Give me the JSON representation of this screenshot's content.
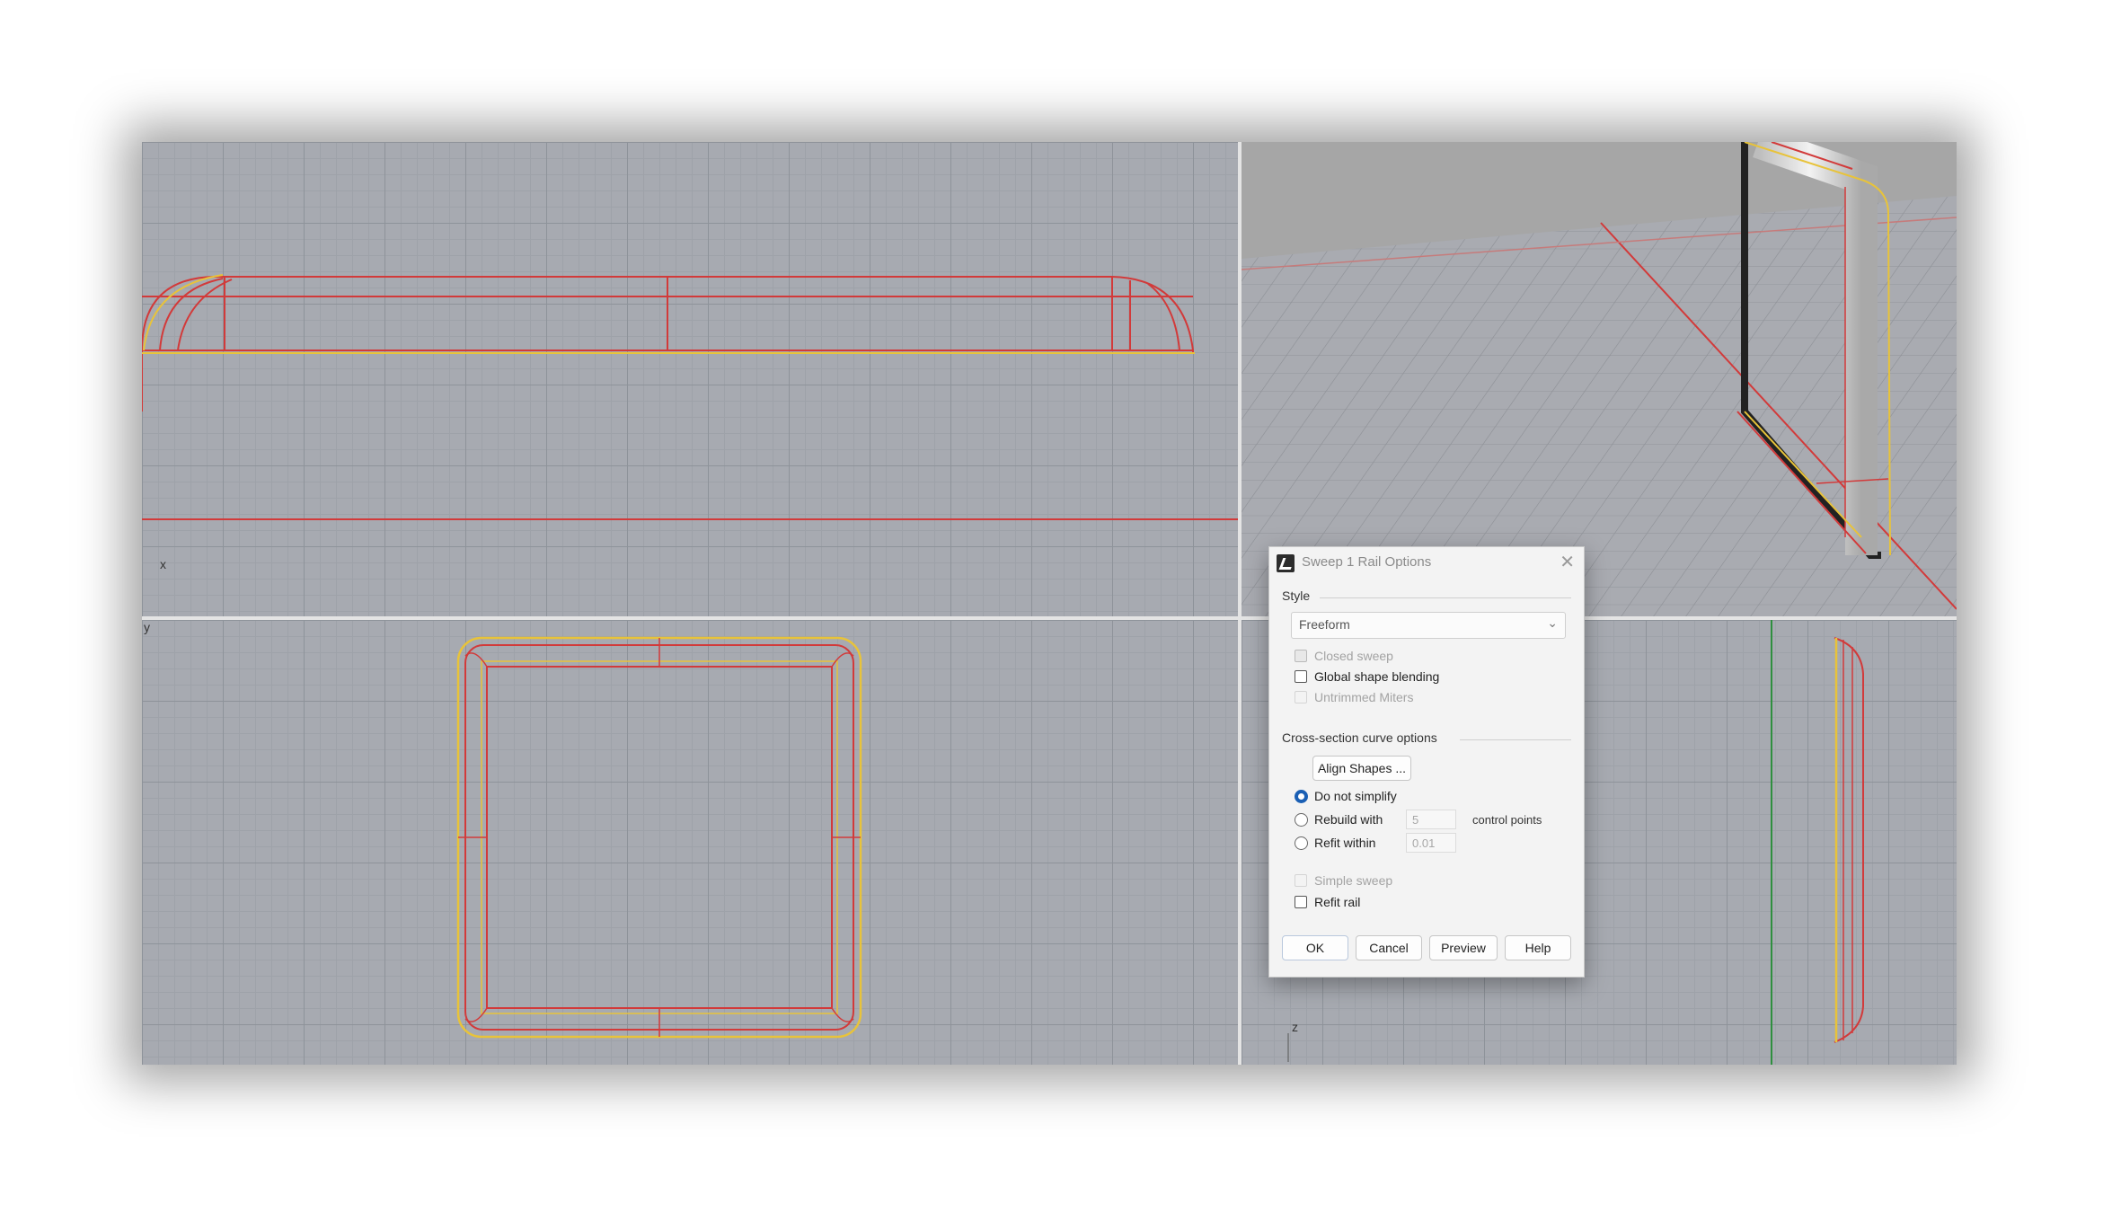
{
  "viewports": {
    "front": {
      "axis_label": "x"
    },
    "top": {
      "axis_label": "y"
    },
    "right": {
      "axis_label": "z"
    }
  },
  "colors": {
    "curve_red": "#d23a3a",
    "curve_yellow": "#e8c33a",
    "axis_green": "#2f8f3f",
    "radio_blue": "#1a5fb4"
  },
  "dialog": {
    "title": "Sweep 1 Rail Options",
    "close_glyph": "✕",
    "style_group": "Style",
    "style_select": {
      "value": "Freeform",
      "chevron": "⌄"
    },
    "options": {
      "closed_sweep": "Closed sweep",
      "global_shape_blending": "Global shape blending",
      "untrimmed_miters": "Untrimmed Miters"
    },
    "cross_section_group": "Cross-section curve options",
    "align_shapes_label": "Align Shapes ...",
    "simplify": {
      "do_not_simplify": "Do not simplify",
      "rebuild_with": "Rebuild with",
      "rebuild_value": "5",
      "control_points": "control points",
      "refit_within": "Refit within",
      "refit_value": "0.01"
    },
    "simple_sweep": "Simple sweep",
    "refit_rail": "Refit rail",
    "buttons": {
      "ok": "OK",
      "cancel": "Cancel",
      "preview": "Preview",
      "help": "Help"
    }
  }
}
